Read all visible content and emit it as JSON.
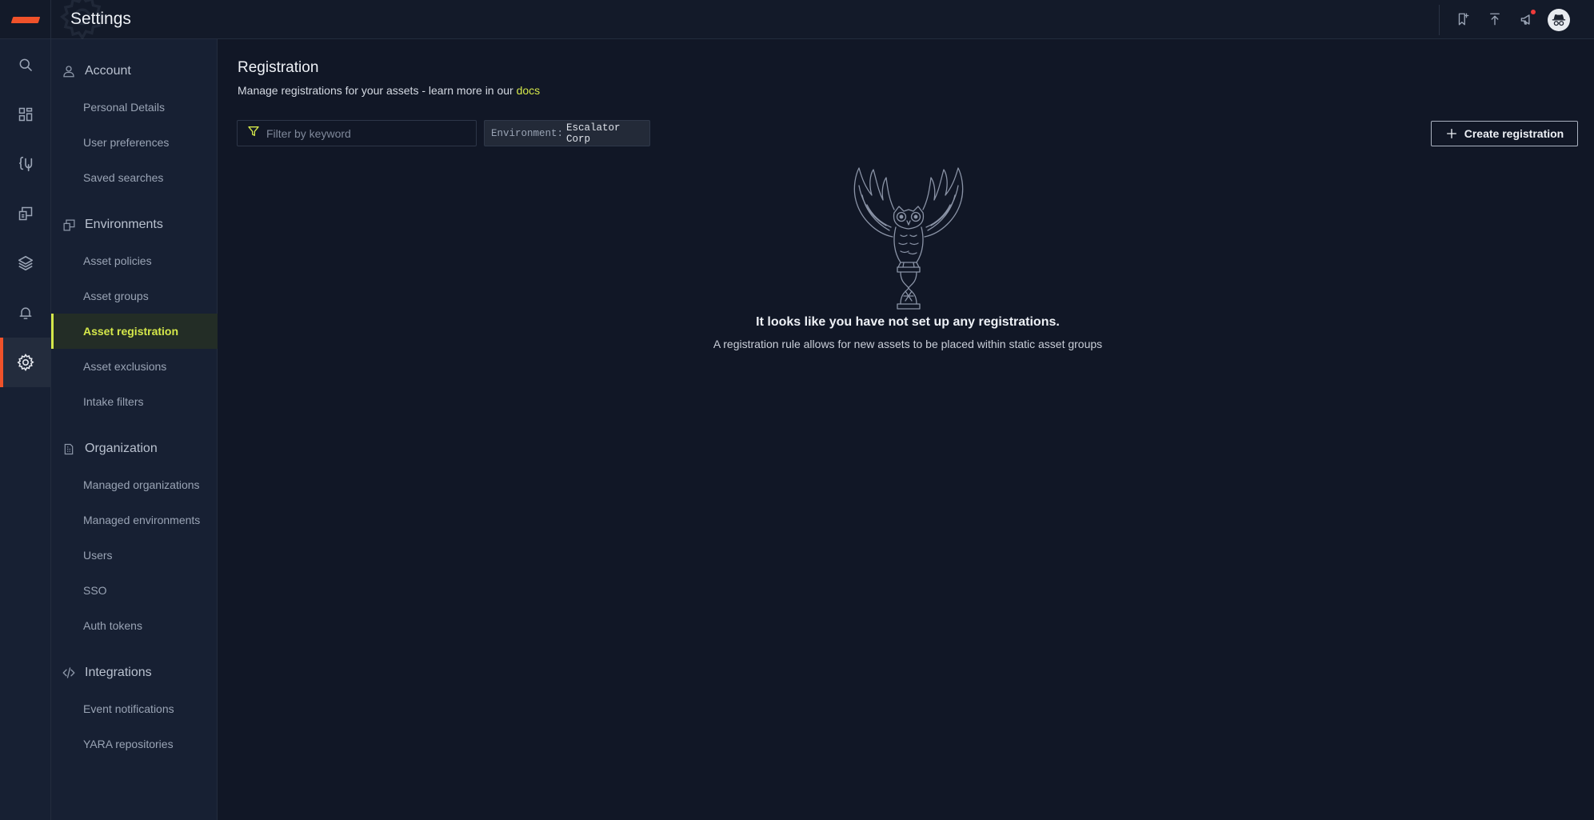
{
  "app": {
    "title": "Settings"
  },
  "topbar": {
    "icons": [
      "bookmark-icon",
      "upload-icon",
      "megaphone-icon",
      "avatar"
    ]
  },
  "rail": {
    "items": [
      "search-icon",
      "dashboard-icon",
      "query-icon",
      "reports-icon",
      "layers-icon",
      "bell-icon",
      "gear-icon"
    ],
    "active": "gear-icon"
  },
  "sidebar": {
    "sections": [
      {
        "title": "Account",
        "icon": "user-icon",
        "items": [
          "Personal Details",
          "User preferences",
          "Saved searches"
        ]
      },
      {
        "title": "Environments",
        "icon": "environments-icon",
        "items": [
          "Asset policies",
          "Asset groups",
          "Asset registration",
          "Asset exclusions",
          "Intake filters"
        ]
      },
      {
        "title": "Organization",
        "icon": "building-icon",
        "items": [
          "Managed organizations",
          "Managed environments",
          "Users",
          "SSO",
          "Auth tokens"
        ]
      },
      {
        "title": "Integrations",
        "icon": "code-icon",
        "items": [
          "Event notifications",
          "YARA repositories"
        ]
      }
    ],
    "active_item": "Asset registration"
  },
  "main": {
    "title": "Registration",
    "subtitle_prefix": "Manage registrations for your assets - learn more in our ",
    "subtitle_link": "docs",
    "filter_placeholder": "Filter by keyword",
    "environment_key": "Environment:",
    "environment_value": "Escalator Corp",
    "create_label": "Create registration",
    "empty_title": "It looks like you have not set up any registrations.",
    "empty_subtitle": "A registration rule allows for new assets to be placed within static asset groups"
  },
  "colors": {
    "background": "#111726",
    "panel": "#172033",
    "accent_lime": "#d5e84a",
    "accent_orange": "#f0522a",
    "notification": "#ef3b3b"
  }
}
